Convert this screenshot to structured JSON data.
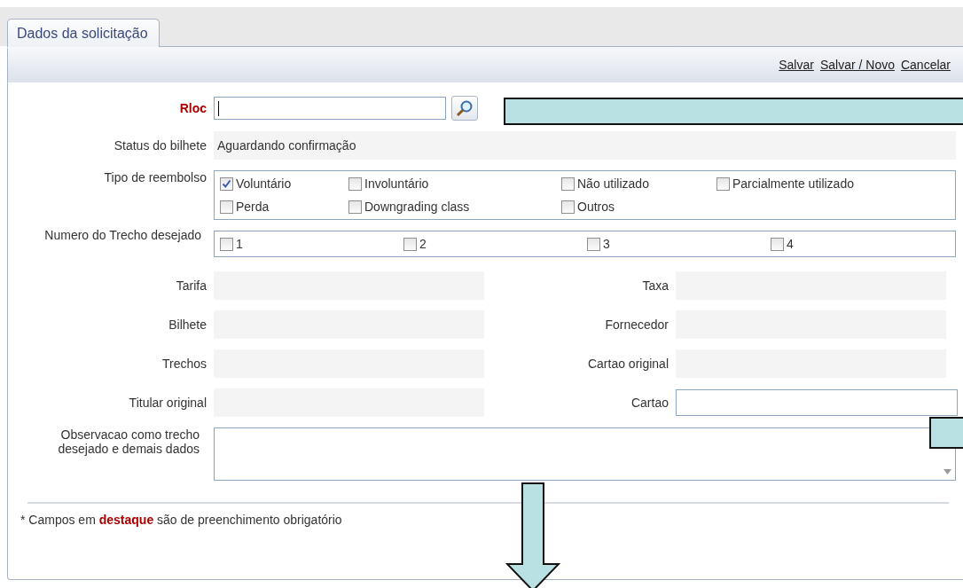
{
  "tabs": [
    {
      "label": "Dados da solicitação",
      "selected": true
    }
  ],
  "toolbar": {
    "links": [
      "Salvar",
      "Salvar / Novo",
      "Cancelar"
    ]
  },
  "rloc": {
    "label": "Rloc",
    "required": true
  },
  "status": {
    "label": "Status do bilhete",
    "value": "Aguardando confirmação"
  },
  "refund_type": {
    "label": "Tipo de reembolso",
    "options": [
      {
        "label": "Voluntário",
        "checked": true
      },
      {
        "label": "Involuntário",
        "checked": false
      },
      {
        "label": "Não utilizado",
        "checked": false
      },
      {
        "label": "Parcialmente utilizado",
        "checked": false
      },
      {
        "label": "Perda",
        "checked": false
      },
      {
        "label": "Downgrading class",
        "checked": false
      },
      {
        "label": "Outros",
        "checked": false
      }
    ]
  },
  "segment": {
    "label": "Numero do Trecho desejado",
    "options": [
      {
        "label": "1",
        "checked": false
      },
      {
        "label": "2",
        "checked": false
      },
      {
        "label": "3",
        "checked": false
      },
      {
        "label": "4",
        "checked": false
      }
    ]
  },
  "fields": [
    {
      "label": "Tarifa",
      "kind": "readonly"
    },
    {
      "label": "Taxa",
      "kind": "readonly"
    },
    {
      "label": "Bilhete",
      "kind": "readonly"
    },
    {
      "label": "Fornecedor",
      "kind": "readonly"
    },
    {
      "label": "Trechos",
      "kind": "readonly"
    },
    {
      "label": "Cartao original",
      "kind": "readonly"
    },
    {
      "label": "Titular original",
      "kind": "readonly"
    },
    {
      "label": "Cartao",
      "kind": "input"
    }
  ],
  "notes": {
    "label": "Observacao como trecho desejado e demais dados"
  },
  "footer": "* Campos em **destaque** são de preenchimento obrigatório"
}
